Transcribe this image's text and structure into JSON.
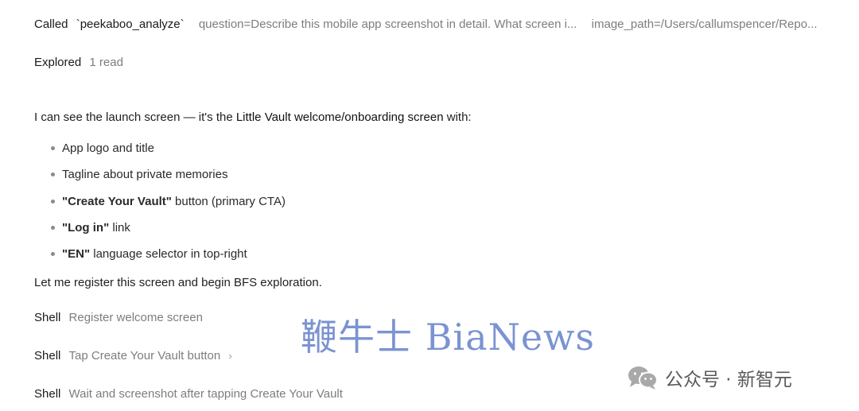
{
  "tool_call": {
    "called_label": "Called",
    "tool_name": "`peekaboo_analyze`",
    "arg_question": "question=Describe this mobile app screenshot in detail. What screen i...",
    "arg_image_path": "image_path=/Users/callumspencer/Repo..."
  },
  "explored": {
    "label": "Explored",
    "detail": "1 read"
  },
  "intro": {
    "prefix": "I can see the launch screen — it's the ",
    "highlight": "Little Vault welcome/onboarding screen",
    "suffix": " with:"
  },
  "bullets": [
    {
      "bold": "",
      "text": "App logo and title"
    },
    {
      "bold": "",
      "text": "Tagline about private memories"
    },
    {
      "bold": "\"Create Your Vault\"",
      "text": " button (primary CTA)"
    },
    {
      "bold": "\"Log in\"",
      "text": " link"
    },
    {
      "bold": "\"EN\"",
      "text": " language selector in top-right"
    }
  ],
  "followup": "Let me register this screen and begin BFS exploration.",
  "shell_rows": [
    {
      "label": "Shell",
      "text": "Register welcome screen"
    },
    {
      "label": "Shell",
      "text": "Tap Create Your Vault button",
      "chevron": "›"
    },
    {
      "label": "Shell",
      "text": "Wait and screenshot after tapping Create Your Vault"
    }
  ],
  "watermark": "鞭牛士 BiaNews",
  "wechat_label": "公众号 · 新智元",
  "colors": {
    "watermark": "#5f7cc8",
    "muted": "#7d7d7d"
  }
}
